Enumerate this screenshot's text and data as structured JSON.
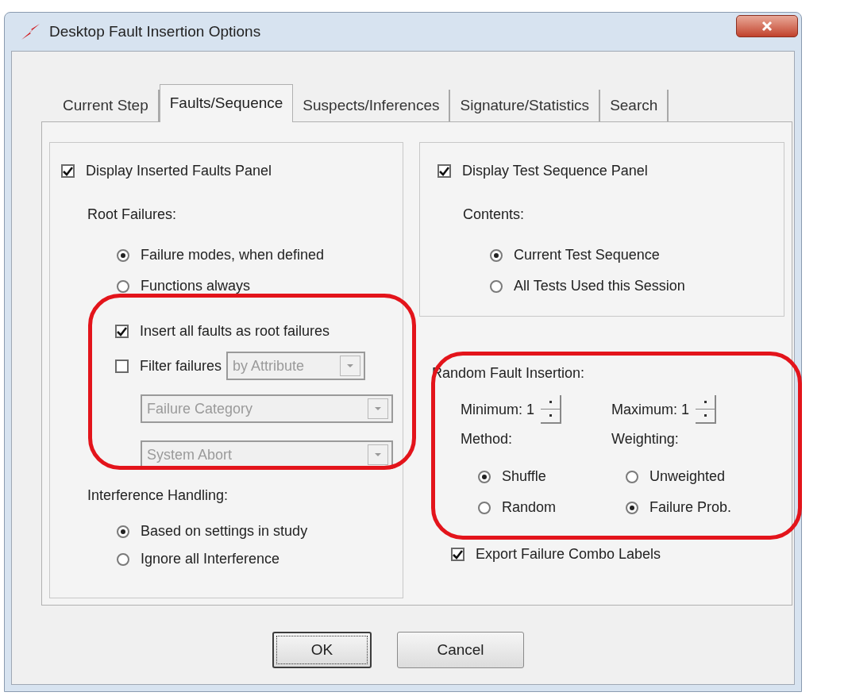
{
  "window": {
    "title": "Desktop Fault Insertion Options"
  },
  "tabs": [
    {
      "label": "Current Step",
      "selected": false
    },
    {
      "label": "Faults/Sequence",
      "selected": true
    },
    {
      "label": "Suspects/Inferences",
      "selected": false
    },
    {
      "label": "Signature/Statistics",
      "selected": false
    },
    {
      "label": "Search",
      "selected": false
    }
  ],
  "faults_panel": {
    "display": {
      "label": "Display Inserted Faults Panel",
      "checked": true
    },
    "root_failures": {
      "label": "Root Failures:",
      "options": [
        {
          "label": "Failure modes, when defined",
          "selected": true
        },
        {
          "label": "Functions always",
          "selected": false
        }
      ]
    },
    "insert_all": {
      "label": "Insert all faults as root failures",
      "checked": true
    },
    "filter": {
      "label": "Filter failures",
      "checked": false,
      "dropdown": {
        "value": "by Attribute",
        "disabled": true
      }
    },
    "dropdowns": [
      {
        "value": "Failure Category",
        "disabled": true
      },
      {
        "value": "System Abort",
        "disabled": true
      }
    ],
    "interference": {
      "label": "Interference Handling:",
      "options": [
        {
          "label": "Based on settings in study",
          "selected": true
        },
        {
          "label": "Ignore all Interference",
          "selected": false
        }
      ]
    }
  },
  "sequence_panel": {
    "display": {
      "label": "Display Test Sequence Panel",
      "checked": true
    },
    "contents": {
      "label": "Contents:",
      "options": [
        {
          "label": "Current Test Sequence",
          "selected": true
        },
        {
          "label": "All Tests Used this Session",
          "selected": false
        }
      ]
    }
  },
  "random_insertion": {
    "label": "Random Fault Insertion:",
    "minimum": {
      "label": "Minimum:",
      "value": "1"
    },
    "maximum": {
      "label": "Maximum:",
      "value": "1"
    },
    "method": {
      "label": "Method:",
      "options": [
        {
          "label": "Shuffle",
          "selected": true
        },
        {
          "label": "Random",
          "selected": false
        }
      ]
    },
    "weighting": {
      "label": "Weighting:",
      "options": [
        {
          "label": "Unweighted",
          "selected": false
        },
        {
          "label": "Failure Prob.",
          "selected": true
        }
      ]
    }
  },
  "export": {
    "label": "Export Failure Combo Labels",
    "checked": true
  },
  "buttons": [
    {
      "label": "OK",
      "default": true
    },
    {
      "label": "Cancel",
      "default": false
    }
  ]
}
